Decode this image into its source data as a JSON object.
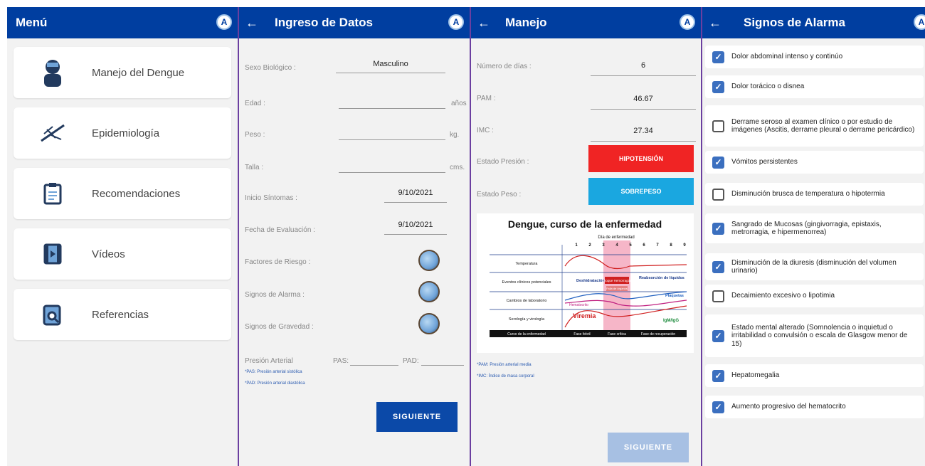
{
  "screen1": {
    "title": "Menú",
    "items": [
      {
        "label": "Manejo del Dengue"
      },
      {
        "label": "Epidemiología"
      },
      {
        "label": "Recomendaciones"
      },
      {
        "label": "Vídeos"
      },
      {
        "label": "Referencias"
      }
    ]
  },
  "screen2": {
    "title": "Ingreso de Datos",
    "back": "←",
    "sexo_label": "Sexo Biológico :",
    "sexo_value": "Masculino",
    "edad_label": "Edad :",
    "edad_unit": "años",
    "peso_label": "Peso :",
    "peso_unit": "kg.",
    "talla_label": "Talla :",
    "talla_unit": "cms.",
    "inicio_label": "Inicio Síntomas :",
    "inicio_value": "9/10/2021",
    "fecha_label": "Fecha de Evaluación :",
    "fecha_value": "9/10/2021",
    "factores_label": "Factores de Riesgo :",
    "signos_alarma_label": "Signos de Alarma :",
    "signos_gravedad_label": "Signos de Gravedad :",
    "presion_label": "Presión Arterial",
    "pas_label": "PAS:",
    "pad_label": "PAD:",
    "note1": "*PAS: Presión arterial sistólica",
    "note2": "*PAD: Presión arterial diastólica",
    "button": "SIGUIENTE"
  },
  "screen3": {
    "title": "Manejo",
    "back": "←",
    "dias_label": "Número de días :",
    "dias_value": "6",
    "pam_label": "PAM :",
    "pam_value": "46.67",
    "imc_label": "IMC :",
    "imc_value": "27.34",
    "presion_label": "Estado Presión :",
    "presion_value": "HIPOTENSIÓN",
    "peso_label": "Estado Peso :",
    "peso_value": "SOBREPESO",
    "note1": "*PAM: Presión arterial media",
    "note2": "*IMC: Índice de masa corporal",
    "button": "SIGUIENTE",
    "colors": {
      "hipotension": "#f02424",
      "sobrepeso": "#1aa7e0"
    },
    "chart": {
      "title": "Dengue, curso de la enfermedad",
      "days_title": "Día de enfermedad",
      "days": [
        "1",
        "2",
        "3",
        "4",
        "5",
        "6",
        "7",
        "8",
        "9"
      ],
      "rows": [
        "Temperatura",
        "Eventos clínicos potenciales",
        "Cambios de laboratorio",
        "Serología y virología"
      ],
      "labels": {
        "deshidratacion": "Deshidratación",
        "choque": "Choque Hemorragias",
        "reabsorcion": "Reabsorción de líquidos",
        "falla": "Falla de órganos",
        "plaquetas": "Plaquetas",
        "hematocrito": "Hematocrito",
        "viremia": "Viremia",
        "igm": "IgM/IgG"
      },
      "phases": [
        "Curso de la enfermedad",
        "Fase febril",
        "Fase crítica",
        "Fase de recuperación"
      ]
    }
  },
  "screen4": {
    "title": "Signos de Alarma",
    "back": "←",
    "items": [
      {
        "text": "Dolor abdominal intenso y continúo",
        "checked": true
      },
      {
        "text": "Dolor torácico o disnea",
        "checked": true
      },
      {
        "text": "Derrame seroso al examen clínico o por estudio de imágenes (Ascitis, derrame pleural o derrame pericárdico)",
        "checked": false
      },
      {
        "text": "Vómitos persistentes",
        "checked": true
      },
      {
        "text": "Disminución brusca de temperatura o hipotermia",
        "checked": false
      },
      {
        "text": "Sangrado de Mucosas (gingivorragia, epistaxis, metrorragia, e hipermenorrea)",
        "checked": true
      },
      {
        "text": "Disminución de la diuresis (disminución del volumen urinario)",
        "checked": true
      },
      {
        "text": "Decaimiento excesivo o lipotimia",
        "checked": false
      },
      {
        "text": "Estado mental alterado (Somnolencia o inquietud o irritabilidad o convulsión o escala de Glasgow menor de 15)",
        "checked": true
      },
      {
        "text": "Hepatomegalia",
        "checked": true
      },
      {
        "text": "Aumento progresivo del hematocrito",
        "checked": true
      }
    ]
  },
  "icons": {
    "logo": "A",
    "check": "✓"
  }
}
